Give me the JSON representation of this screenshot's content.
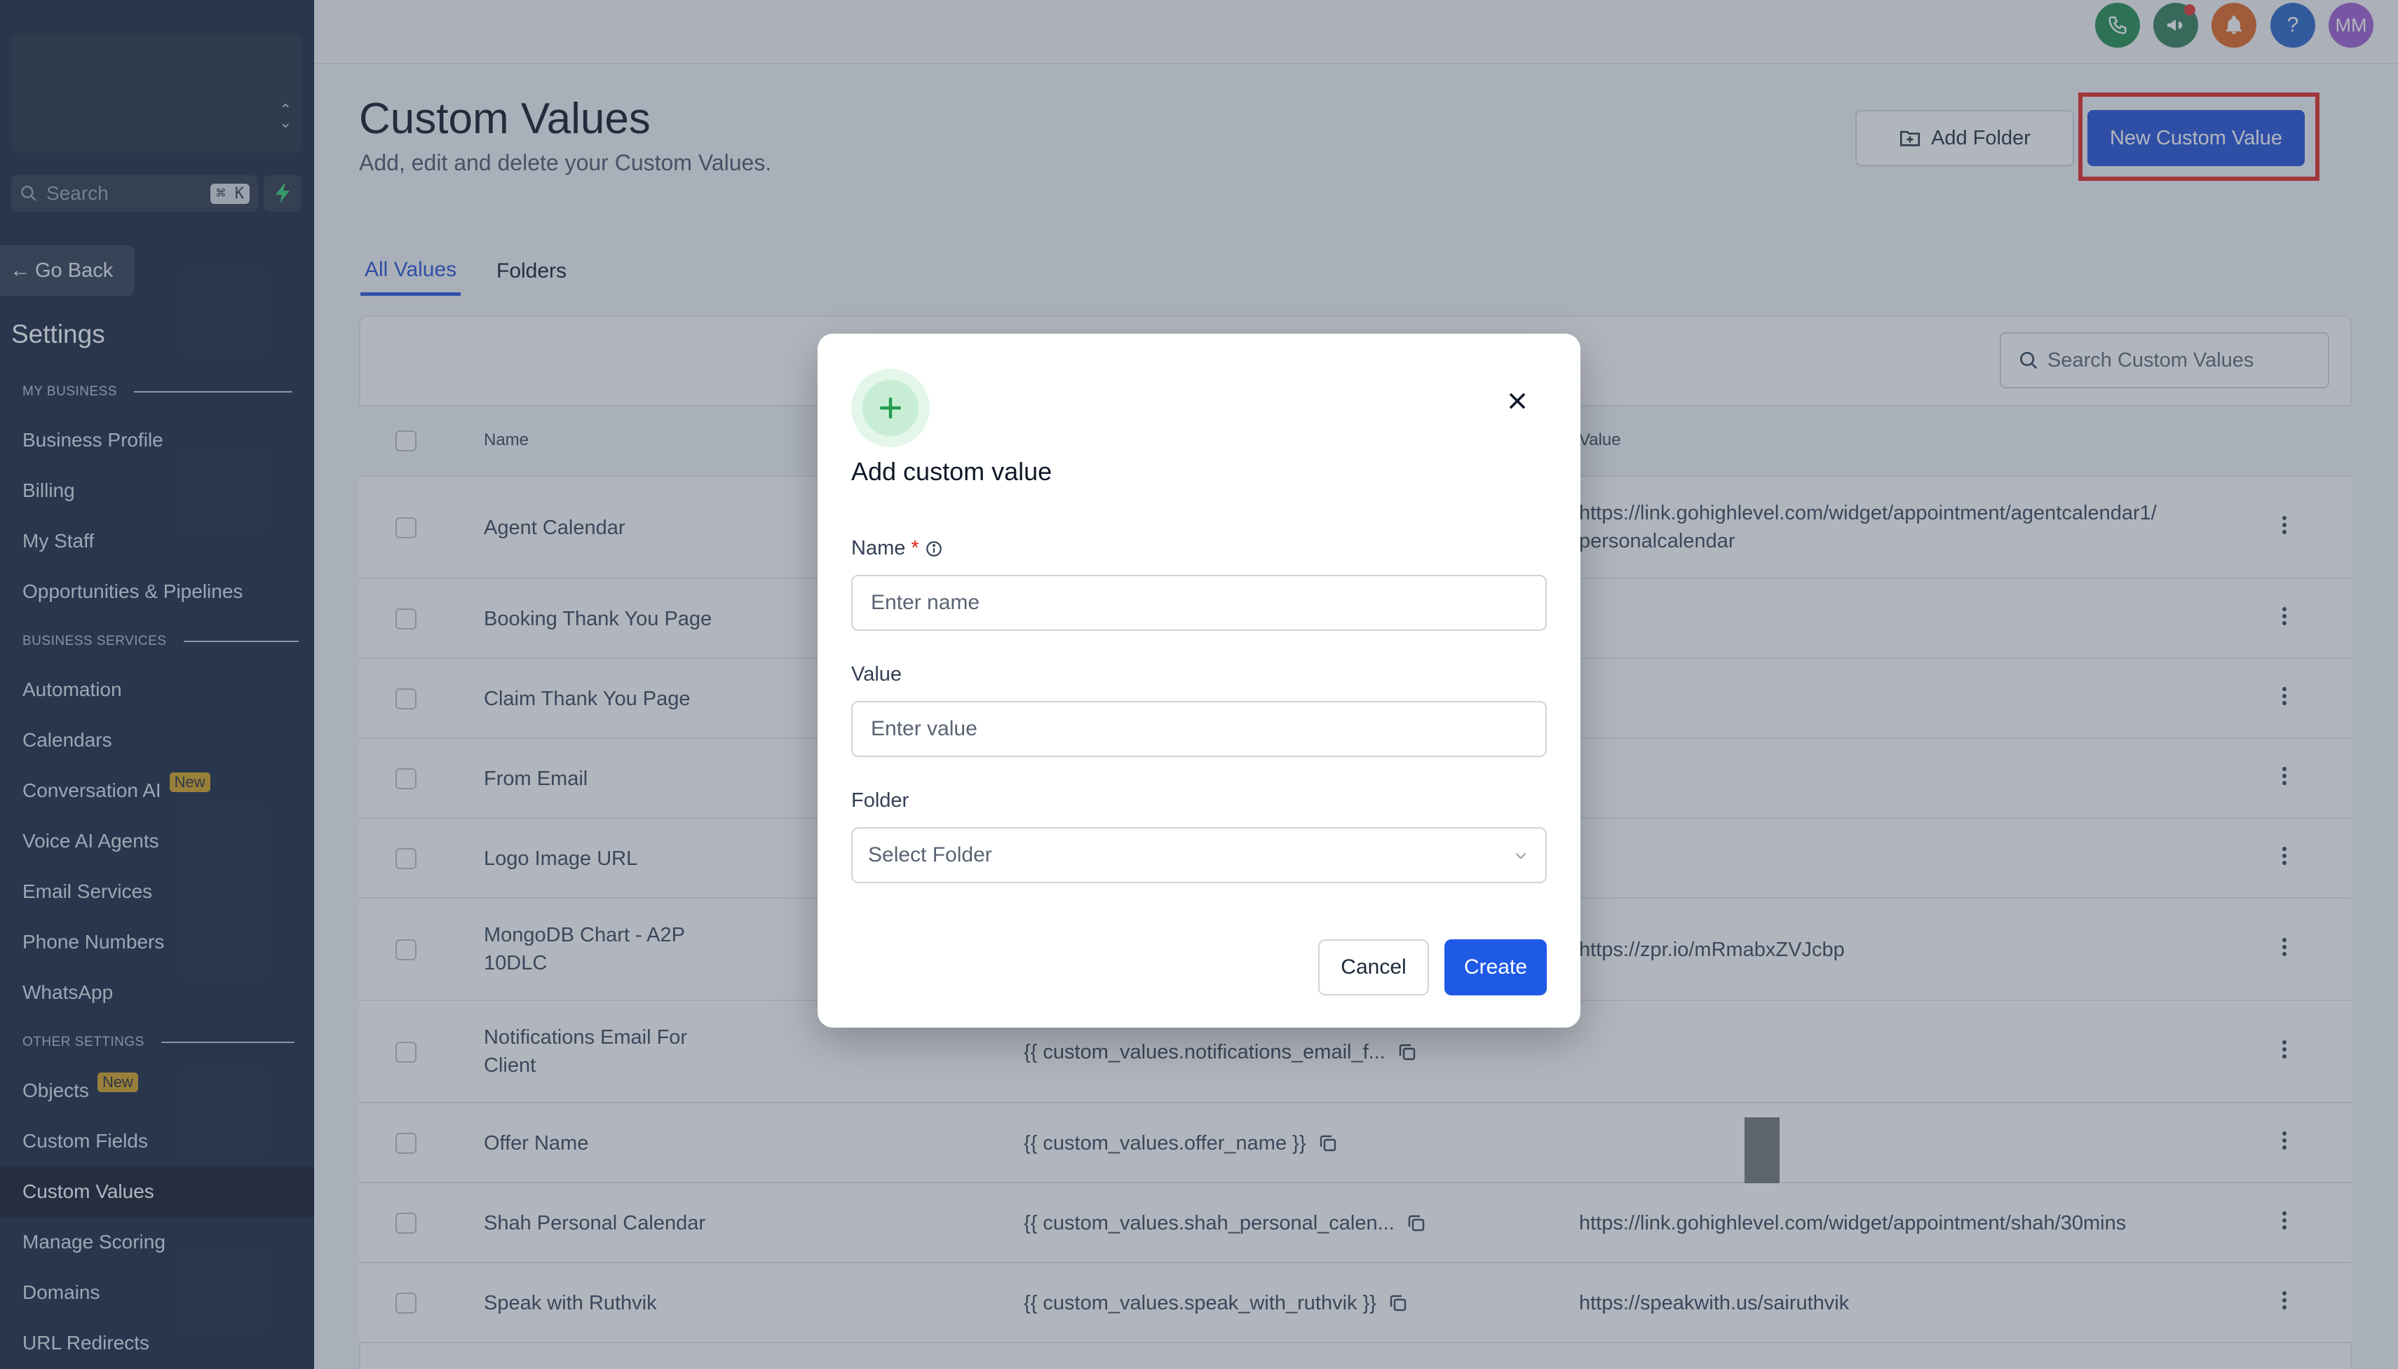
{
  "sidebar": {
    "search_placeholder": "Search",
    "search_shortcut": "⌘ K",
    "go_back": "Go Back",
    "settings_title": "Settings",
    "sections": {
      "my_business": "MY BUSINESS",
      "business_services": "BUSINESS SERVICES",
      "other_settings": "OTHER SETTINGS"
    },
    "items": [
      {
        "label": "Business Profile"
      },
      {
        "label": "Billing"
      },
      {
        "label": "My Staff"
      },
      {
        "label": "Opportunities & Pipelines"
      },
      {
        "label": "Automation"
      },
      {
        "label": "Calendars"
      },
      {
        "label": "Conversation AI",
        "badge": "New"
      },
      {
        "label": "Voice AI Agents"
      },
      {
        "label": "Email Services"
      },
      {
        "label": "Phone Numbers"
      },
      {
        "label": "WhatsApp"
      },
      {
        "label": "Objects",
        "badge": "New"
      },
      {
        "label": "Custom Fields"
      },
      {
        "label": "Custom Values",
        "active": true
      },
      {
        "label": "Manage Scoring"
      },
      {
        "label": "Domains"
      },
      {
        "label": "URL Redirects"
      }
    ]
  },
  "topbar": {
    "avatar_initials": "MM",
    "help_label": "?",
    "colors": {
      "phone": "#1c8a4a",
      "megaphone": "#2f7a55",
      "bell": "#e0631c",
      "help": "#2563c9",
      "avatar": "#9b5ad0"
    }
  },
  "page": {
    "title": "Custom Values",
    "subtitle": "Add, edit and delete your Custom Values.",
    "add_folder_label": "Add Folder",
    "new_custom_value_label": "New Custom Value",
    "tabs": [
      {
        "label": "All Values",
        "active": true
      },
      {
        "label": "Folders",
        "active": false
      }
    ],
    "search_placeholder": "Search Custom Values"
  },
  "table": {
    "columns": {
      "name": "Name",
      "value": "Value"
    },
    "rows": [
      {
        "name": "Agent Calendar",
        "key": "",
        "value": "https://link.gohighlevel.com/widget/appointment/agentcalendar1/\npersonalcalendar"
      },
      {
        "name": "Booking Thank You Page",
        "key": "",
        "value": ""
      },
      {
        "name": "Claim Thank You Page",
        "key": "",
        "value": ""
      },
      {
        "name": "From Email",
        "key": "",
        "value": ""
      },
      {
        "name": "Logo Image URL",
        "key": "",
        "value": ""
      },
      {
        "name": "MongoDB Chart - A2P\n10DLC",
        "key": "",
        "value": "https://zpr.io/mRmabxZVJcbp"
      },
      {
        "name": "Notifications Email For\nClient",
        "key": "{{ custom_values.notifications_email_f...",
        "value": ""
      },
      {
        "name": "Offer Name",
        "key": "{{ custom_values.offer_name }}",
        "value": ""
      },
      {
        "name": "Shah Personal Calendar",
        "key": "{{ custom_values.shah_personal_calen...",
        "value": "https://link.gohighlevel.com/widget/appointment/shah/30mins"
      },
      {
        "name": "Speak with Ruthvik",
        "key": "{{ custom_values.speak_with_ruthvik }}",
        "value": "https://speakwith.us/sairuthvik"
      }
    ]
  },
  "modal": {
    "title": "Add custom value",
    "name_label": "Name",
    "required_mark": "*",
    "name_placeholder": "Enter name",
    "value_label": "Value",
    "value_placeholder": "Enter value",
    "folder_label": "Folder",
    "folder_placeholder": "Select Folder",
    "cancel_label": "Cancel",
    "create_label": "Create"
  }
}
